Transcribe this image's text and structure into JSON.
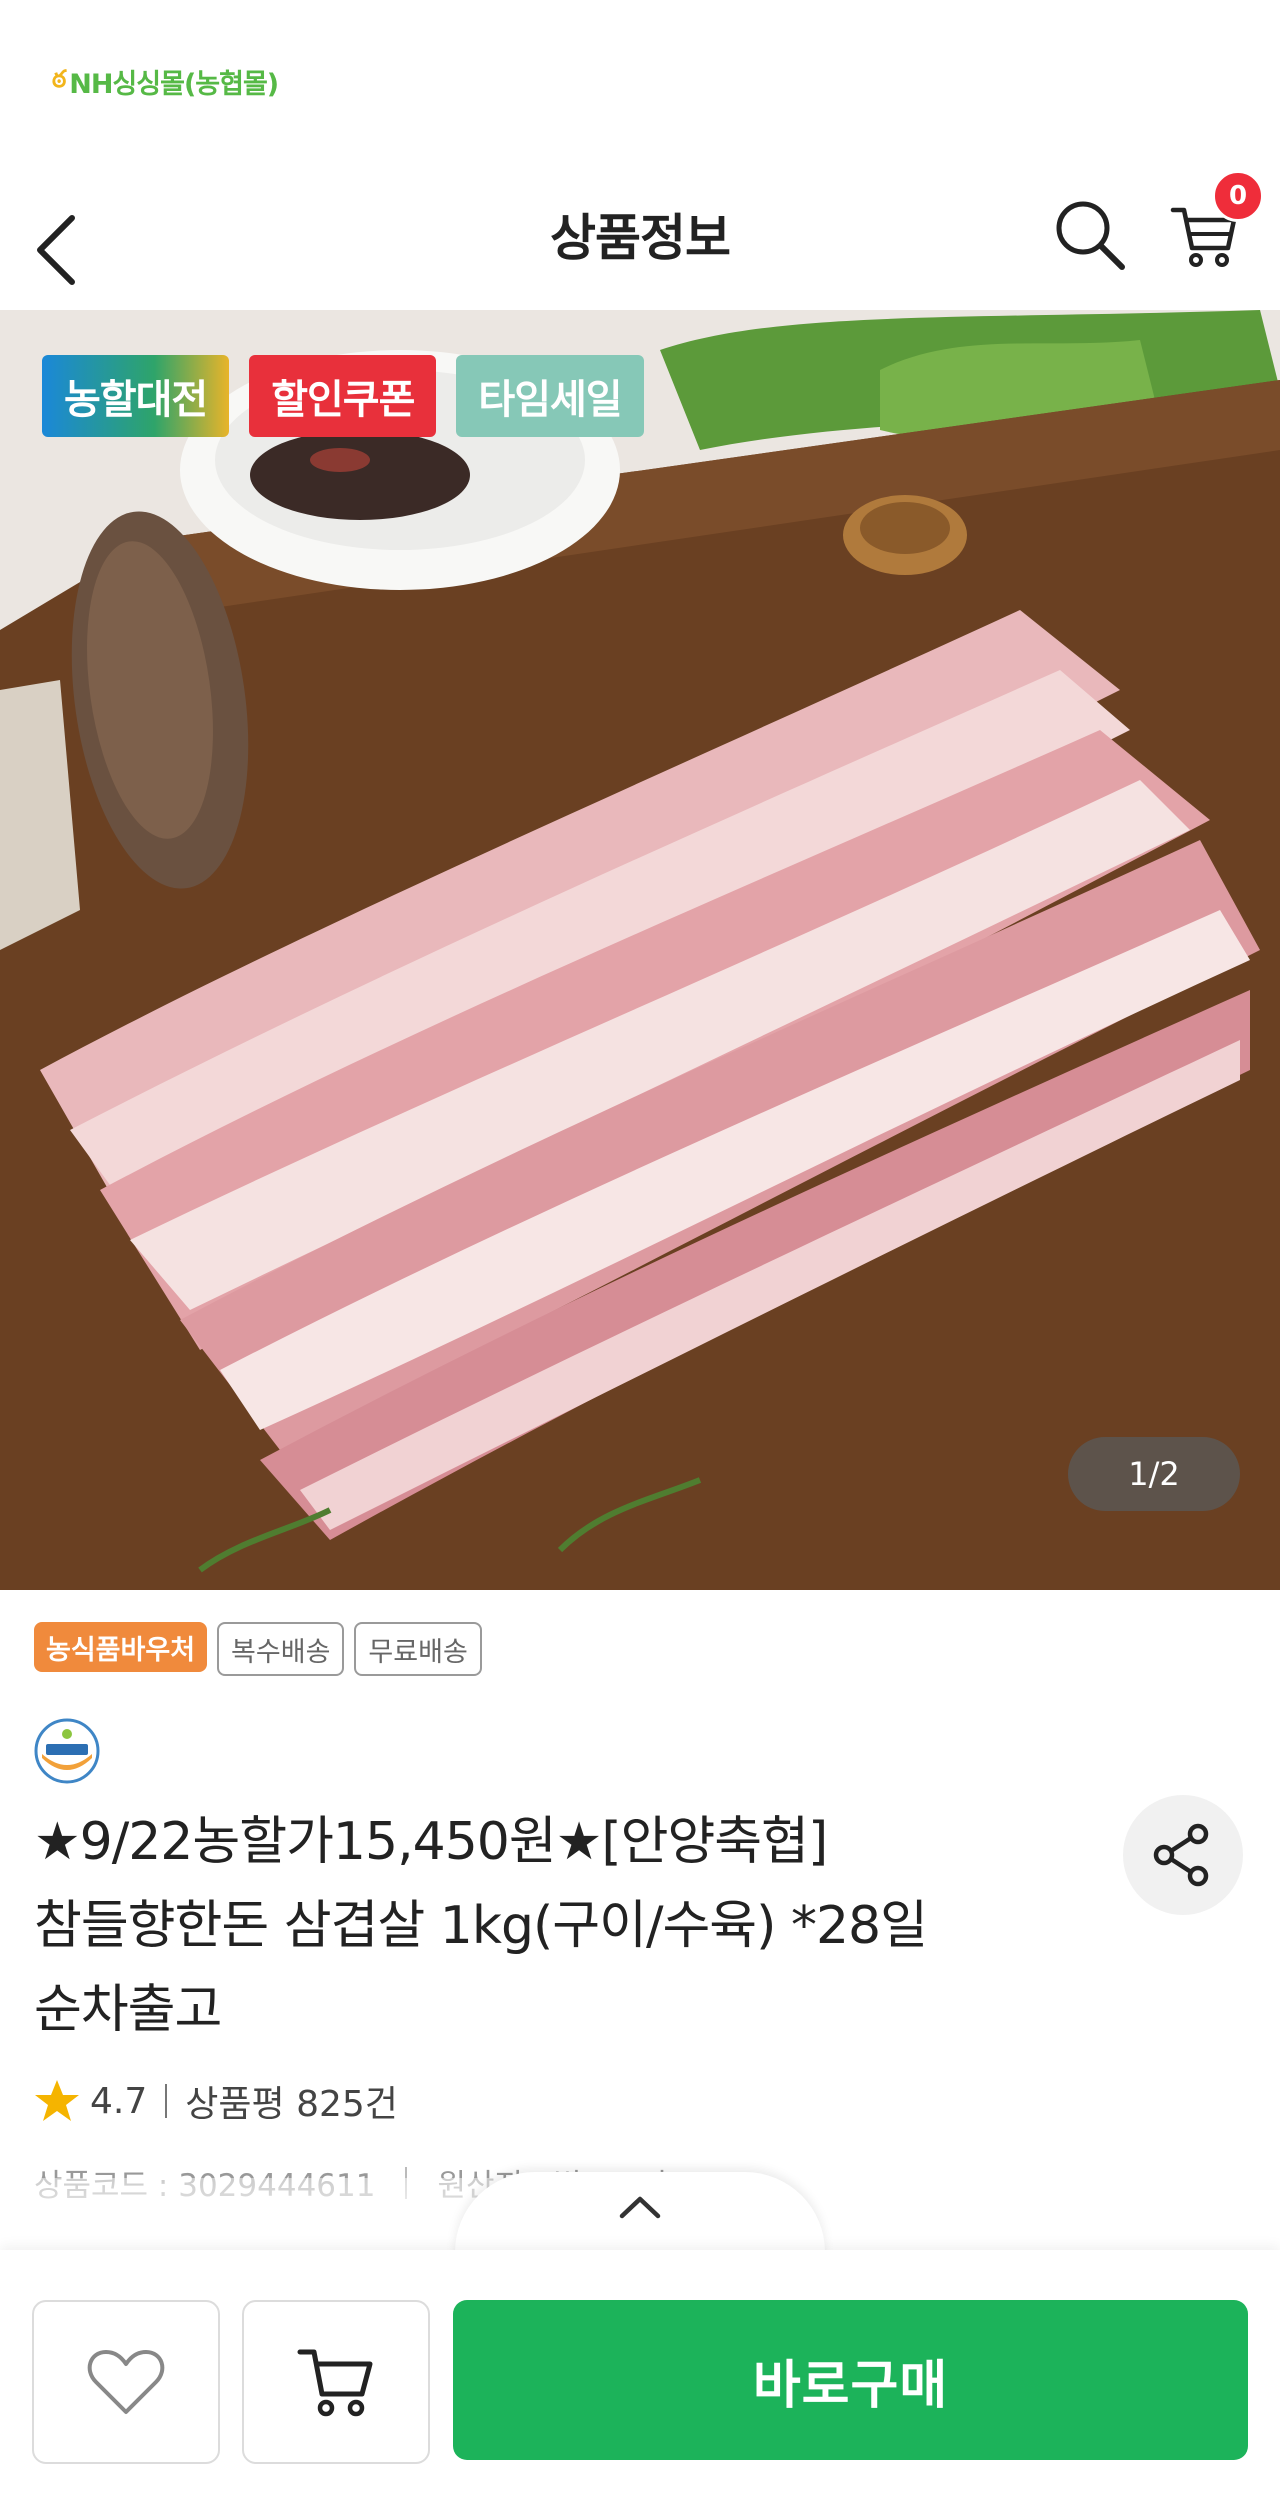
{
  "mall": {
    "logo_text": "NH싱싱몰(농협몰)"
  },
  "header": {
    "title": "상품정보",
    "cart_count": "0"
  },
  "hero": {
    "badges": [
      "농할대전",
      "할인쿠폰",
      "타임세일"
    ],
    "pager": "1/2"
  },
  "tags": [
    "농식품바우처",
    "복수배송",
    "무료배송"
  ],
  "product": {
    "title_line1": "★9/22농할가15,450원★[안양축협]",
    "title_line2": "참들향한돈 삼겹살 1kg(구이/수육) *28일",
    "title_line3": "순차출고",
    "rating": "4.7",
    "review_label": "상품평 825건",
    "code_label": "상품코드 : 3029444611",
    "origin_label": "원산지 : 별도표기"
  },
  "bottom": {
    "buy_label": "바로구매"
  },
  "colors": {
    "brand_green": "#1cb35a",
    "badge_red": "#ef2d3a",
    "voucher_orange": "#f08a3c",
    "star": "#f5b400"
  },
  "icons": [
    "back-chevron-icon",
    "search-icon",
    "cart-icon",
    "share-icon",
    "star-icon",
    "chevron-up-icon",
    "heart-icon",
    "cart-add-icon",
    "haccp-logo"
  ]
}
